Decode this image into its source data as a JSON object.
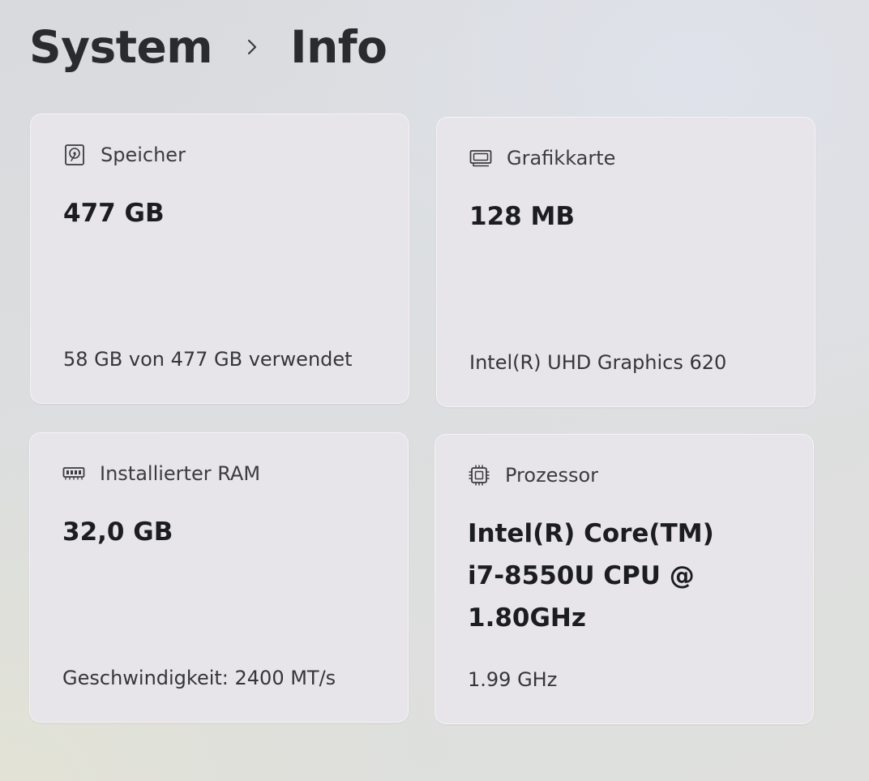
{
  "breadcrumb": {
    "parent": "System",
    "current": "Info"
  },
  "cards": {
    "storage": {
      "icon": "hard-drive-icon",
      "label": "Speicher",
      "value": "477 GB",
      "detail": "58 GB von 477 GB verwendet"
    },
    "graphics": {
      "icon": "graphics-card-icon",
      "label": "Grafikkarte",
      "value": "128 MB",
      "detail": "Intel(R) UHD Graphics 620"
    },
    "ram": {
      "icon": "ram-icon",
      "label": "Installierter RAM",
      "value": "32,0 GB",
      "detail": "Geschwindigkeit: 2400 MT/s"
    },
    "processor": {
      "icon": "processor-icon",
      "label": "Prozessor",
      "value": "Intel(R) Core(TM) i7-8550U CPU @ 1.80GHz",
      "detail": "1.99 GHz"
    }
  }
}
